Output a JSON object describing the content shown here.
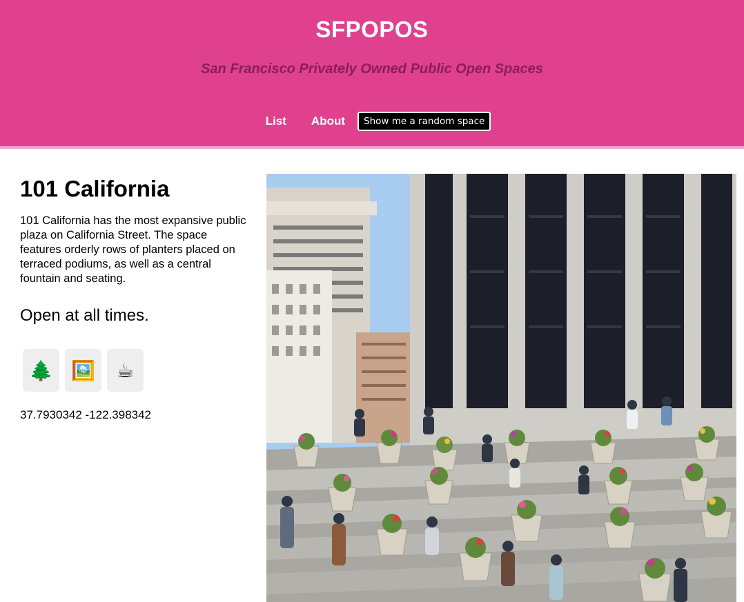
{
  "header": {
    "title": "SFPOPOS",
    "subtitle": "San Francisco Privately Owned Public Open Spaces",
    "bg_color": "#df418e",
    "subtitle_color": "#8a1f55"
  },
  "nav": {
    "list_label": "List",
    "about_label": "About",
    "random_button_label": "Show me a random space"
  },
  "space": {
    "name": "101 California",
    "description": "101 California has the most expansive public plaza on California Street. The space features orderly rows of planters placed on terraced podiums, as well as a central fountain and seating.",
    "hours": "Open at all times.",
    "amenities": [
      {
        "icon": "🌲",
        "name": "tree-icon"
      },
      {
        "icon": "🖼️",
        "name": "framed-picture-icon"
      },
      {
        "icon": "☕",
        "name": "coffee-icon"
      }
    ],
    "coordinates": "37.7930342 -122.398342",
    "photo_subject": "plaza-photo"
  }
}
